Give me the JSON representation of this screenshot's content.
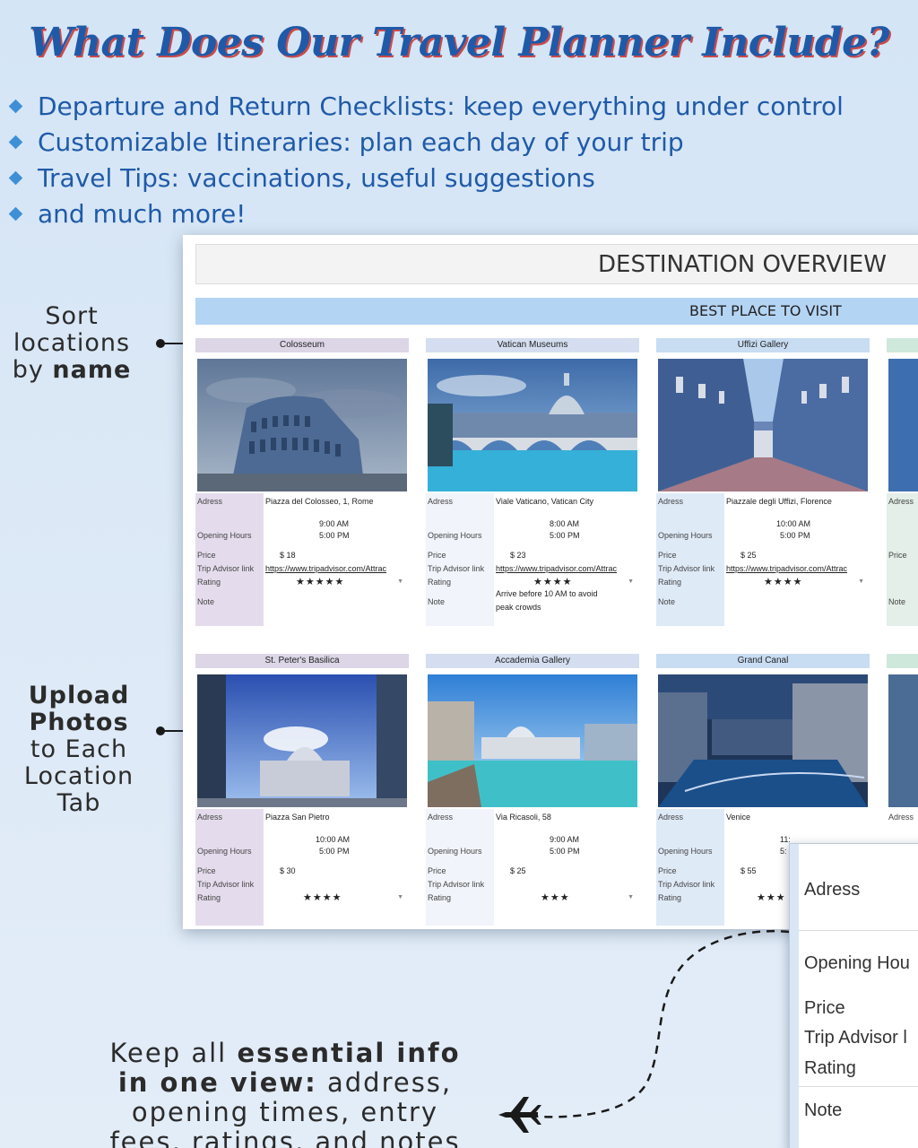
{
  "header": {
    "title": "What Does Our Travel Planner Include?",
    "features": [
      "Departure and Return Checklists: keep everything under control",
      "Customizable Itineraries: plan each day of your trip",
      "Travel Tips: vaccinations, useful suggestions",
      "and much more!"
    ]
  },
  "callouts": {
    "sort": {
      "l1": "Sort",
      "l2": "locations",
      "l3a": "by ",
      "l3b": "name"
    },
    "upload": {
      "l1": "Upload",
      "l2": "Photos",
      "l3": "to Each",
      "l4": "Location Tab"
    },
    "bottom": {
      "a": "Keep all ",
      "b": "essential info in one view:",
      "c": " address, opening times, entry fees, ratings, and notes"
    }
  },
  "sheet": {
    "title": "DESTINATION OVERVIEW",
    "banner": "BEST PLACE TO VISIT",
    "labels": {
      "address": "Adress",
      "hours": "Opening Hours",
      "price": "Price",
      "link": "Trip Advisor link",
      "rating": "Rating",
      "note": "Note"
    },
    "cards": [
      {
        "name": "Colosseum",
        "address": "Piazza del Colosseo, 1, Rome",
        "open": "9:00 AM",
        "close": "5:00 PM",
        "price": "$ 18",
        "link": "https://www.tripadvisor.com/Attrac",
        "rating": "★★★★★",
        "note": ""
      },
      {
        "name": "Vatican Museums",
        "address": "Viale Vaticano, Vatican City",
        "open": "8:00 AM",
        "close": "5:00 PM",
        "price": "$ 23",
        "link": "https://www.tripadvisor.com/Attrac",
        "rating": "★★★★",
        "note": "Arrive before 10 AM to avoid peak crowds"
      },
      {
        "name": "Uffizi Gallery",
        "address": "Piazzale degli Uffizi, Florence",
        "open": "10:00 AM",
        "close": "5:00 PM",
        "price": "$ 25",
        "link": "https://www.tripadvisor.com/Attrac",
        "rating": "★★★★",
        "note": ""
      },
      {
        "name": "St. Peter's Basilica",
        "address": "Piazza San Pietro",
        "open": "10:00 AM",
        "close": "5:00 PM",
        "price": "$ 30",
        "link": "",
        "rating": "★★★★",
        "note": ""
      },
      {
        "name": "Accademia Gallery",
        "address": "Via Ricasoli, 58",
        "open": "9:00 AM",
        "close": "5:00 PM",
        "price": "$ 25",
        "link": "",
        "rating": "★★★",
        "note": ""
      },
      {
        "name": "Grand Canal",
        "address": "Venice",
        "open": "11:",
        "close": "5:",
        "price": "$ 55",
        "link": "",
        "rating": "★★★",
        "note": ""
      }
    ]
  },
  "zoom": {
    "address": "Adress",
    "hours": "Opening Hou",
    "price": "Price",
    "link": "Trip Advisor l",
    "rating": "Rating",
    "note": "Note"
  },
  "colors": {
    "title": "#1f5aa8",
    "title_shadow": "#c94b4b",
    "banner": "#b4d4f4",
    "purple_col": "#e4dcec",
    "blue_col": "#d8e6f6"
  }
}
